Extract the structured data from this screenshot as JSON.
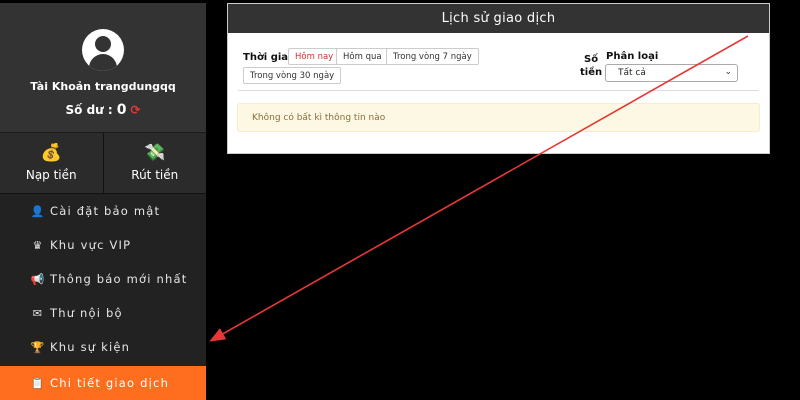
{
  "sidebar": {
    "account_label": "Tài Khoản trangdungqq",
    "balance_label": "Số dư :",
    "balance_value": "0",
    "actions": {
      "deposit": "Nạp tiền",
      "withdraw": "Rút tiền"
    },
    "menu": [
      {
        "label": "Cài đặt bảo mật",
        "icon": "user-lock-icon"
      },
      {
        "label": "Khu vực VIP",
        "icon": "crown-icon"
      },
      {
        "label": "Thông báo mới nhất",
        "icon": "megaphone-icon"
      },
      {
        "label": "Thư nội bộ",
        "icon": "envelope-icon"
      },
      {
        "label": "Khu sự kiện",
        "icon": "trophy-icon"
      },
      {
        "label": "Chi tiết giao dịch",
        "icon": "clipboard-icon",
        "active": true
      }
    ]
  },
  "panel": {
    "title": "Lịch sử giao dịch",
    "time_label": "Thời gian",
    "time_options": [
      "Hôm nay",
      "Hôm qua",
      "Trong vòng 7 ngày",
      "Trong vòng 30 ngày"
    ],
    "time_selected": "Hôm nay",
    "amount_label_line1": "Số",
    "amount_label_line2": "tiền",
    "type_label": "Phân loại",
    "type_selected": "Tất cả",
    "empty_message": "Không có bất kì thông tin nào"
  },
  "colors": {
    "accent": "#ff6d1f",
    "annotation_arrow": "#e53935"
  }
}
